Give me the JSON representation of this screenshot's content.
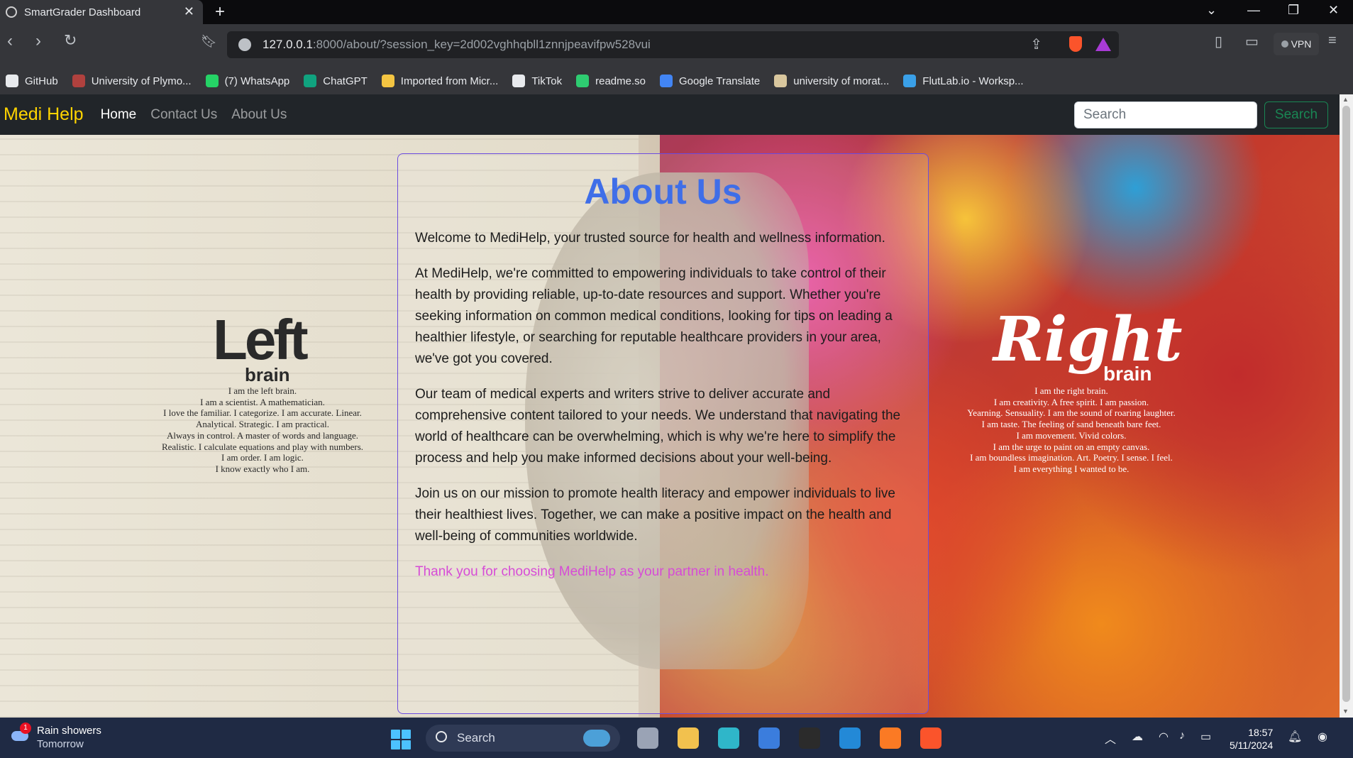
{
  "browser": {
    "tab_title": "SmartGrader Dashboard",
    "tab_close": "✕",
    "new_tab": "+",
    "url_host": "127.0.0.1",
    "url_rest": ":8000/about/?session_key=2d002vghhqbll1znnjpeavifpw528vui",
    "vpn_label": "VPN",
    "bookmarks": [
      {
        "label": "GitHub",
        "color": "#e8eaed"
      },
      {
        "label": "University of Plymo...",
        "color": "#b0413e"
      },
      {
        "label": "(7) WhatsApp",
        "color": "#25d366"
      },
      {
        "label": "ChatGPT",
        "color": "#10a37f"
      },
      {
        "label": "Imported from Micr...",
        "color": "#f4c542"
      },
      {
        "label": "TikTok",
        "color": "#e8eaed"
      },
      {
        "label": "readme.so",
        "color": "#2ecc71"
      },
      {
        "label": "Google Translate",
        "color": "#4285f4"
      },
      {
        "label": "university of morat...",
        "color": "#d9c79e"
      },
      {
        "label": "FlutLab.io - Worksp...",
        "color": "#3aa0e8"
      }
    ]
  },
  "site": {
    "brand": "Medi Help",
    "nav": [
      "Home",
      "Contact Us",
      "About Us"
    ],
    "search_placeholder": "Search",
    "search_button": "Search"
  },
  "background": {
    "left_title": "Left",
    "left_sub": "brain",
    "left_poem": [
      "I am the left brain.",
      "I am a scientist. A mathematician.",
      "I love the familiar. I categorize. I am accurate. Linear.",
      "Analytical. Strategic. I am practical.",
      "Always in control. A master of words and language.",
      "Realistic. I calculate equations and play with numbers.",
      "I am order. I am logic.",
      "I know exactly who I am."
    ],
    "right_title": "Right",
    "right_sub": "brain",
    "right_poem": [
      "I am the right brain.",
      "I am creativity. A free spirit. I am passion.",
      "Yearning. Sensuality. I am the sound of roaring laughter.",
      "I am taste. The feeling of sand beneath bare feet.",
      "I am movement. Vivid colors.",
      "I am the urge to paint on an empty canvas.",
      "I am boundless imagination. Art. Poetry. I sense. I feel.",
      "I am everything I wanted to be."
    ]
  },
  "about": {
    "title": "About Us",
    "paragraphs": [
      "Welcome to MediHelp, your trusted source for health and wellness information.",
      "At MediHelp, we're committed to empowering individuals to take control of their health by providing reliable, up-to-date resources and support. Whether you're seeking information on common medical conditions, looking for tips on leading a healthier lifestyle, or searching for reputable healthcare providers in your area, we've got you covered.",
      "Our team of medical experts and writers strive to deliver accurate and comprehensive content tailored to your needs. We understand that navigating the world of healthcare can be overwhelming, which is why we're here to simplify the process and help you make informed decisions about your well-being.",
      "Join us on our mission to promote health literacy and empower individuals to live their healthiest lives. Together, we can make a positive impact on the health and well-being of communities worldwide."
    ],
    "thanks": "Thank you for choosing MediHelp as your partner in health."
  },
  "taskbar": {
    "weather_title": "Rain showers",
    "weather_sub": "Tomorrow",
    "weather_badge": "1",
    "search_label": "Search",
    "time": "18:57",
    "date": "5/11/2024",
    "apps": [
      {
        "name": "task-view-icon",
        "color": "#9aa3b5"
      },
      {
        "name": "file-explorer-icon",
        "color": "#f2c14e"
      },
      {
        "name": "edge-icon",
        "color": "#2fb6c9"
      },
      {
        "name": "store-icon",
        "color": "#3b7ddd"
      },
      {
        "name": "terminal-icon",
        "color": "#2b2b2b"
      },
      {
        "name": "vscode-icon",
        "color": "#2389d7"
      },
      {
        "name": "xampp-icon",
        "color": "#fb7a24"
      },
      {
        "name": "brave-icon",
        "color": "#fb542b"
      }
    ]
  }
}
